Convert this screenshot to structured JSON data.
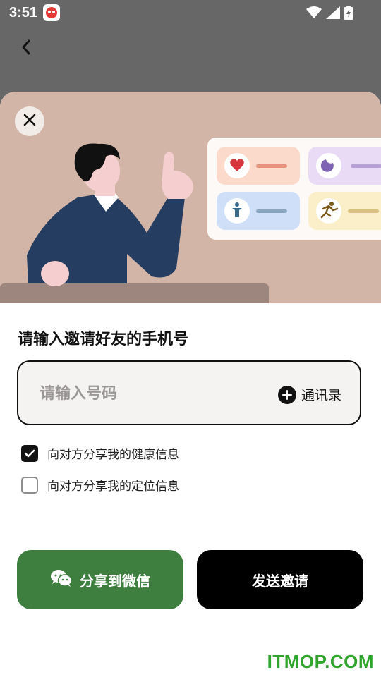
{
  "status_bar": {
    "time": "3:51",
    "icons": [
      "app-notification-icon",
      "wifi-icon",
      "signal-icon",
      "battery-charging-icon"
    ]
  },
  "nav": {
    "back_icon": "chevron-left-icon"
  },
  "sheet": {
    "close_icon": "close-icon",
    "title": "请输入邀请好友的手机号",
    "phone_input": {
      "value": "",
      "placeholder": "请输入号码"
    },
    "contacts_label": "通讯录",
    "options": [
      {
        "label": "向对方分享我的健康信息",
        "checked": true
      },
      {
        "label": "向对方分享我的定位信息",
        "checked": false
      }
    ],
    "share_wechat_label": "分享到微信",
    "send_invite_label": "发送邀请"
  },
  "watermark": "ITMOP.COM",
  "colors": {
    "hero_bg": "#d3b5a8",
    "wechat_green": "#3e7f3f",
    "primary_black": "#000000",
    "watermark_green": "#2fa52c"
  }
}
